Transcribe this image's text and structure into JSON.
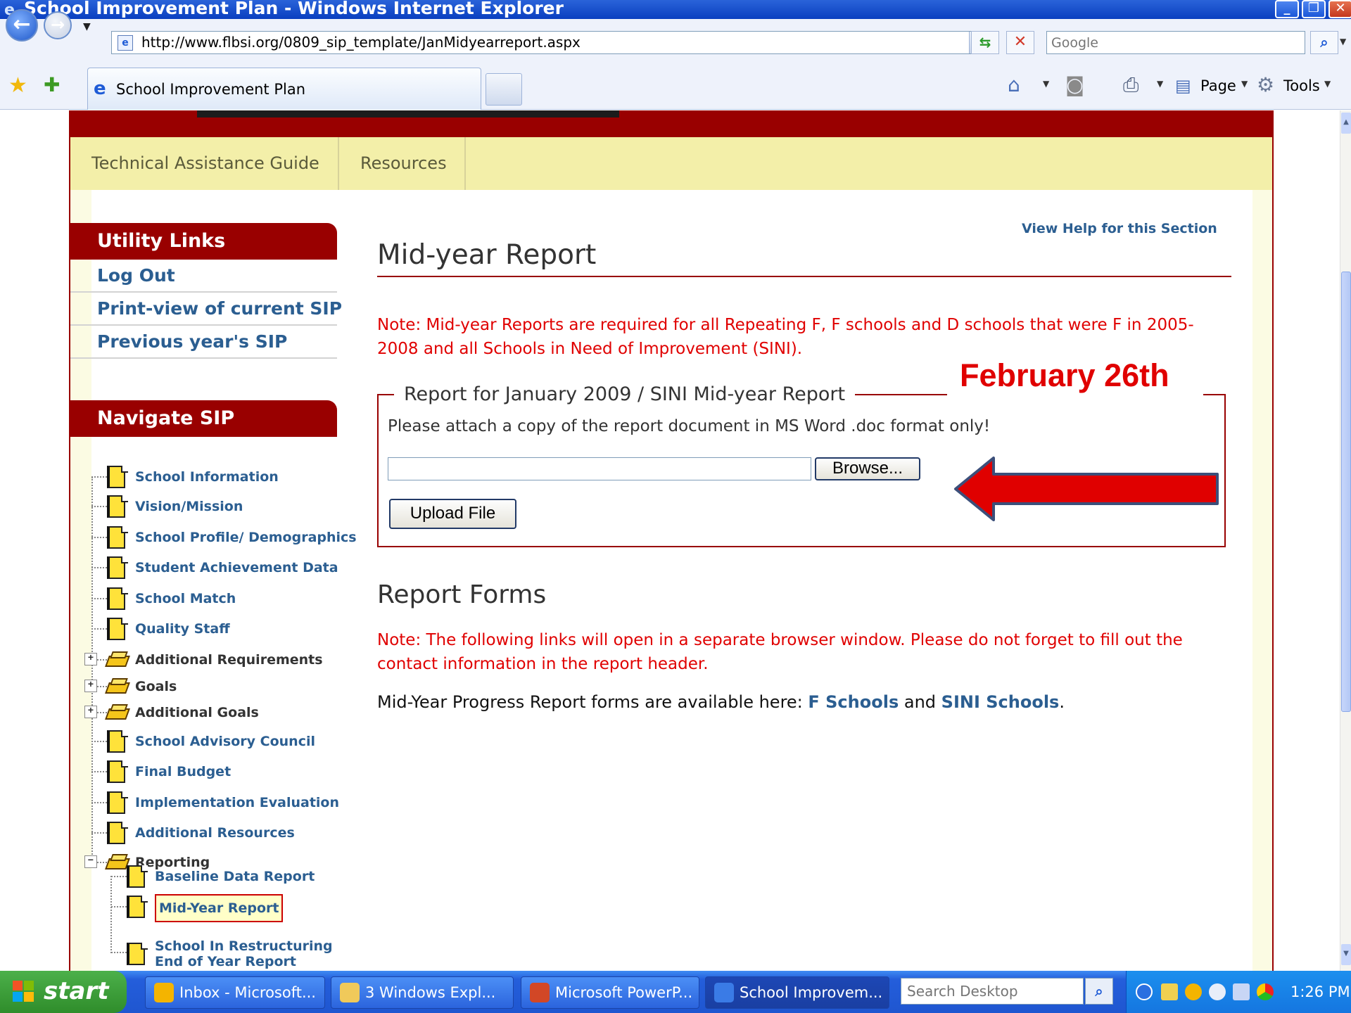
{
  "window": {
    "title": "School Improvement Plan - Windows Internet Explorer"
  },
  "browser": {
    "url": "http://www.flbsi.org/0809_sip_template/JanMidyearreport.aspx",
    "search_placeholder": "Google",
    "tab_title": "School Improvement Plan",
    "commands": {
      "page": "Page",
      "tools": "Tools"
    }
  },
  "topnav": [
    "Technical Assistance Guide",
    "Resources"
  ],
  "sidebar": {
    "utility_title": "Utility Links",
    "utility_links": [
      "Log Out",
      "Print-view of current SIP",
      "Previous year's SIP"
    ],
    "navigate_title": "Navigate SIP",
    "tree": [
      {
        "label": "School Information",
        "icon": "doc"
      },
      {
        "label": "Vision/Mission",
        "icon": "doc"
      },
      {
        "label": "School Profile/ Demographics",
        "icon": "doc"
      },
      {
        "label": "Student Achievement Data",
        "icon": "doc"
      },
      {
        "label": "School Match",
        "icon": "doc"
      },
      {
        "label": "Quality Staff",
        "icon": "doc"
      },
      {
        "label": "Additional Requirements",
        "icon": "book",
        "expander": "+"
      },
      {
        "label": "Goals",
        "icon": "book",
        "expander": "+"
      },
      {
        "label": "Additional Goals",
        "icon": "book",
        "expander": "+"
      },
      {
        "label": "School Advisory Council",
        "icon": "doc"
      },
      {
        "label": "Final Budget",
        "icon": "doc"
      },
      {
        "label": "Implementation Evaluation",
        "icon": "doc"
      },
      {
        "label": "Additional Resources",
        "icon": "doc"
      },
      {
        "label": "Reporting",
        "icon": "book",
        "expander": "−"
      }
    ],
    "reporting_children": [
      "Baseline Data Report",
      "Mid-Year Report",
      "School In Restructuring",
      "End of Year Report"
    ]
  },
  "main": {
    "help_link": "View Help for this Section",
    "title": "Mid-year Report",
    "note1_line1": "Note: Mid-year Reports are required for all Repeating F, F schools and D schools that were F in 2005-",
    "note1_line2": "2008 and all Schools in Need of Improvement (SINI).",
    "fieldset_legend": "Report for January 2009 / SINI Mid-year Report",
    "instruction": "Please attach a copy of the report document in MS Word .doc format only!",
    "browse_label": "Browse...",
    "upload_label": "Upload File",
    "annotation": "February 26th",
    "forms_title": "Report Forms",
    "note2_line1": "Note: The following links will open in a separate browser window. Please do not forget to fill out the",
    "note2_line2": "contact information in the report header.",
    "avail_text": "Mid-Year Progress Report forms are available here: ",
    "avail_link1": "F Schools",
    "avail_and": " and ",
    "avail_link2": "SINI Schools",
    "avail_end": "."
  },
  "taskbar": {
    "start": "start",
    "tasks": [
      "Inbox - Microsoft...",
      "3 Windows Expl...",
      "Microsoft PowerP...",
      "School Improvem..."
    ],
    "search_placeholder": "Search Desktop",
    "clock": "1:26 PM"
  },
  "colors": {
    "brand": "#990000",
    "nav_bg": "#f3efa9",
    "link": "#2b5e91",
    "note": "#e00000"
  }
}
